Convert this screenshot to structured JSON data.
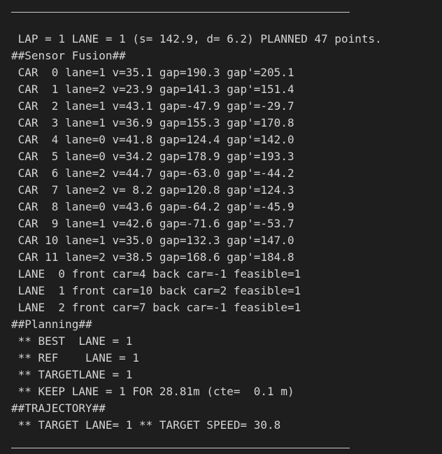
{
  "terminal": {
    "lines": [
      " LAP = 1 LANE = 1 (s= 142.9, d= 6.2) PLANNED 47 points.",
      "##Sensor Fusion##",
      " CAR  0 lane=1 v=35.1 gap=190.3 gap'=205.1",
      " CAR  1 lane=2 v=23.9 gap=141.3 gap'=151.4",
      " CAR  2 lane=1 v=43.1 gap=-47.9 gap'=-29.7",
      " CAR  3 lane=1 v=36.9 gap=155.3 gap'=170.8",
      " CAR  4 lane=0 v=41.8 gap=124.4 gap'=142.0",
      " CAR  5 lane=0 v=34.2 gap=178.9 gap'=193.3",
      " CAR  6 lane=2 v=44.7 gap=-63.0 gap'=-44.2",
      " CAR  7 lane=2 v= 8.2 gap=120.8 gap'=124.3",
      " CAR  8 lane=0 v=43.6 gap=-64.2 gap'=-45.9",
      " CAR  9 lane=1 v=42.6 gap=-71.6 gap'=-53.7",
      " CAR 10 lane=1 v=35.0 gap=132.3 gap'=147.0",
      " CAR 11 lane=2 v=38.5 gap=168.6 gap'=184.8",
      " LANE  0 front car=4 back car=-1 feasible=1",
      " LANE  1 front car=10 back car=2 feasible=1",
      " LANE  2 front car=7 back car=-1 feasible=1",
      "##Planning##",
      " ** BEST  LANE = 1",
      " ** REF    LANE = 1",
      " ** TARGETLANE = 1",
      " ** KEEP LANE = 1 FOR 28.81m (cte=  0.1 m)",
      "##TRAJECTORY##",
      " ** TARGET LANE= 1 ** TARGET SPEED= 30.8"
    ]
  }
}
